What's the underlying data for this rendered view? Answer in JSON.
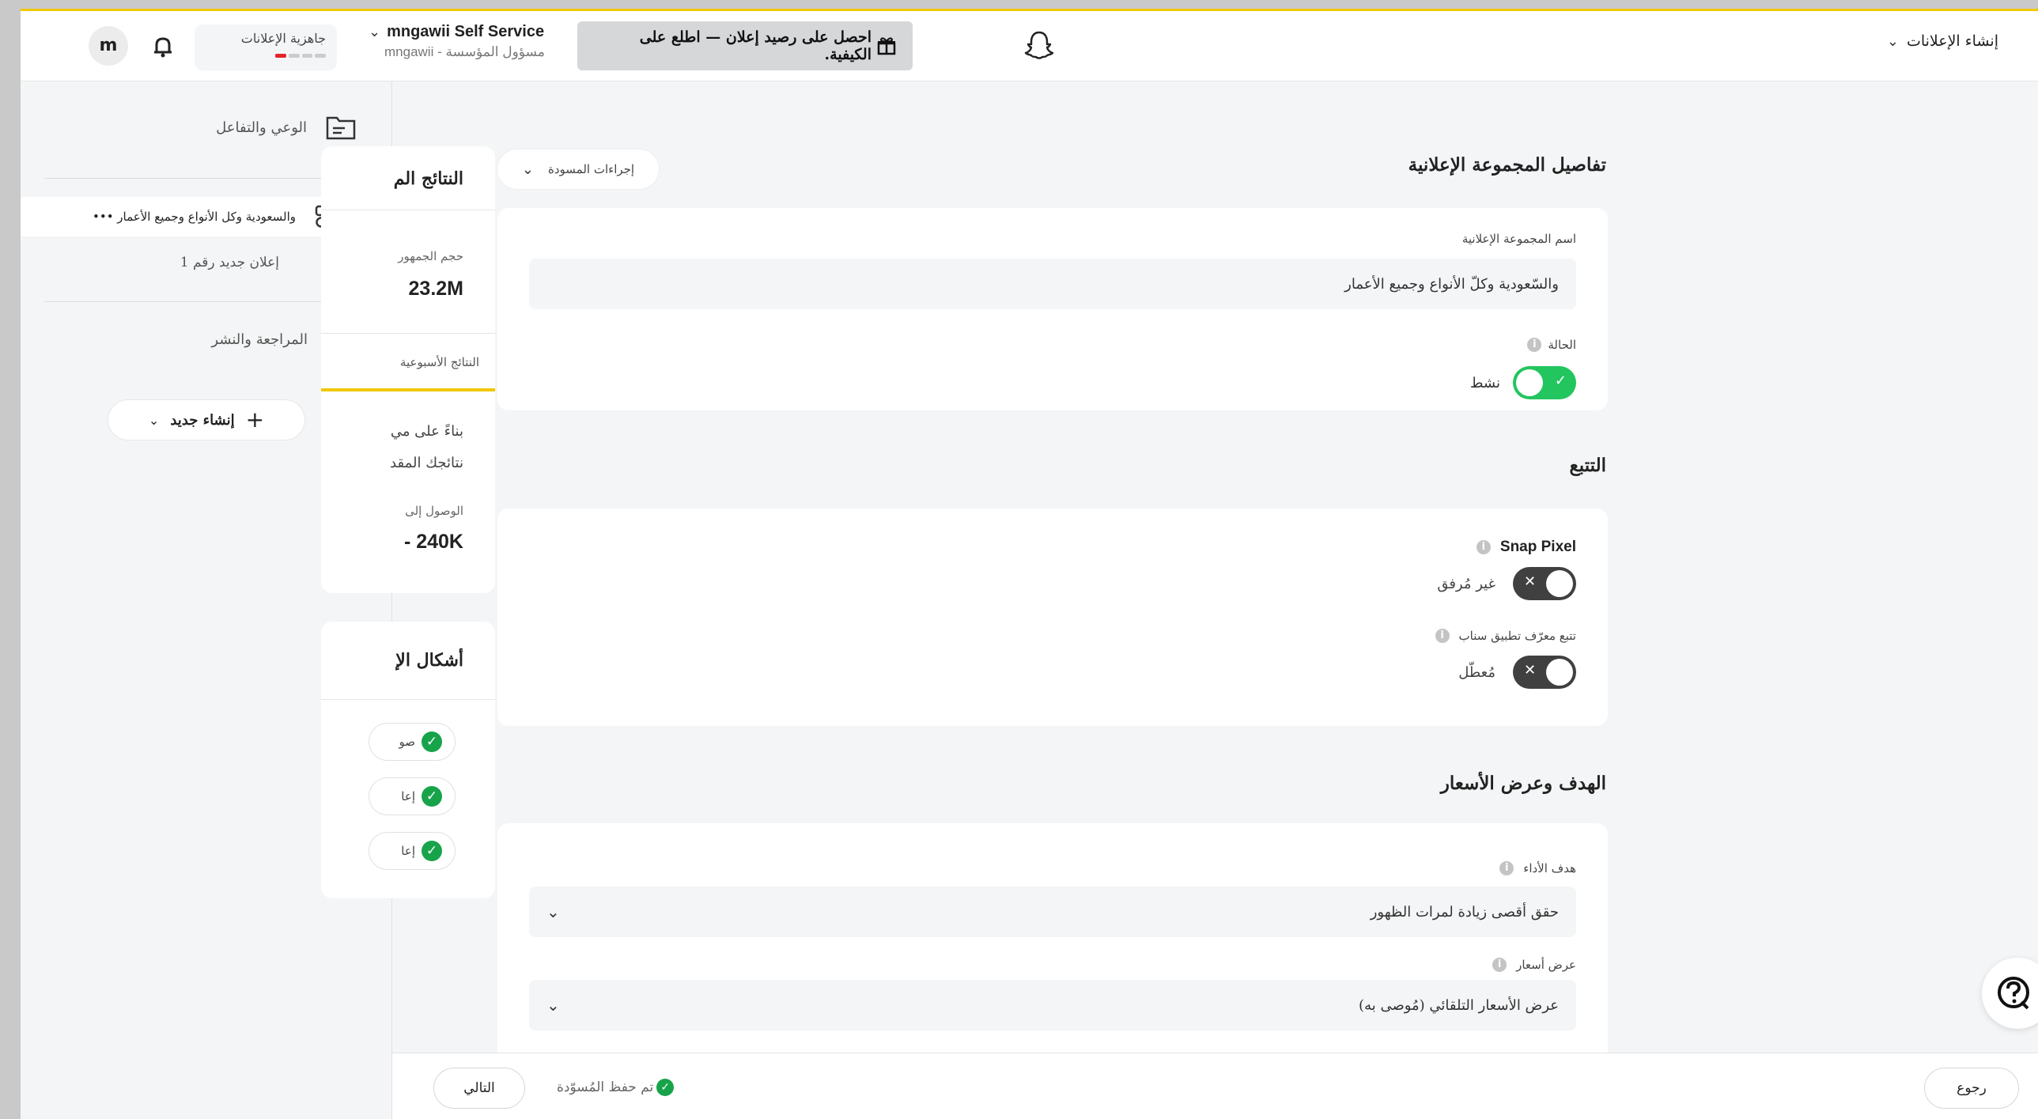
{
  "topbar": {
    "create_ads": "إنشاء الإعلانات",
    "promo": "احصل على رصيد إعلان — اطلع على الكيفية.",
    "account_name": "mngawii Self Service",
    "account_sub": "mngawii - مسؤول المؤسسة",
    "ads_readiness": "جاهزية الإعلانات",
    "avatar_letter": "m"
  },
  "sidebar": {
    "items": [
      {
        "label": "الوعي والتفاعل",
        "icon": "folder-icon"
      },
      {
        "label": "والسعودية وكل الأنواع وجميع الأعمار •••",
        "icon": "ad-group-icon"
      },
      {
        "label": "إعلان جديد رقم 1",
        "icon": "play-icon"
      },
      {
        "label": "المراجعة والنشر",
        "icon": "clipboard-icon"
      }
    ],
    "new_button": "إنشاء جديد"
  },
  "results_panel": {
    "title": "النتائج الم",
    "audience_label": "حجم الجمهور",
    "audience_value": "23.2M",
    "weekly_tab": "النتائج الأسبوعية",
    "text_line1": "بناءً على مي",
    "text_line2": "نتائجك المقد",
    "reach_label": "الوصول إلى",
    "reach_value": "- 240K"
  },
  "formats_panel": {
    "title": "أشكال الإ",
    "items": [
      "صو",
      "إعا",
      "إعا"
    ]
  },
  "draft_actions": "إجراءات المسودة",
  "ad_set_details": {
    "title": "تفاصيل المجموعة الإعلانية",
    "name_label": "اسم المجموعة الإعلانية",
    "name_value": "والسّعودية وكلّ الأنواع  وجميع الأعمار",
    "status_label": "الحالة",
    "status_value": "نشط"
  },
  "tracking": {
    "title": "التتبع",
    "pixel_label": "Snap Pixel",
    "pixel_status": "غير مُرفق",
    "app_id_label": "تتبع معرّف تطبيق سناب",
    "app_id_status": "مُعطّل"
  },
  "goal_bidding": {
    "title": "الهدف وعرض الأسعار",
    "goal_label": "هدف الأداء",
    "goal_value": "حقق أقصى زيادة لمرات الظهور",
    "bid_label": "عرض أسعار",
    "bid_value": "عرض الأسعار التلقائي (مُوصى به)"
  },
  "footer": {
    "back": "رجوع",
    "saved": "تم حفظ المُسوّدة",
    "next": "التالي"
  },
  "colors": {
    "accent_yellow": "#fffc00",
    "toggle_on": "#22c55e",
    "toggle_off": "#404040",
    "success": "#17a34a"
  }
}
